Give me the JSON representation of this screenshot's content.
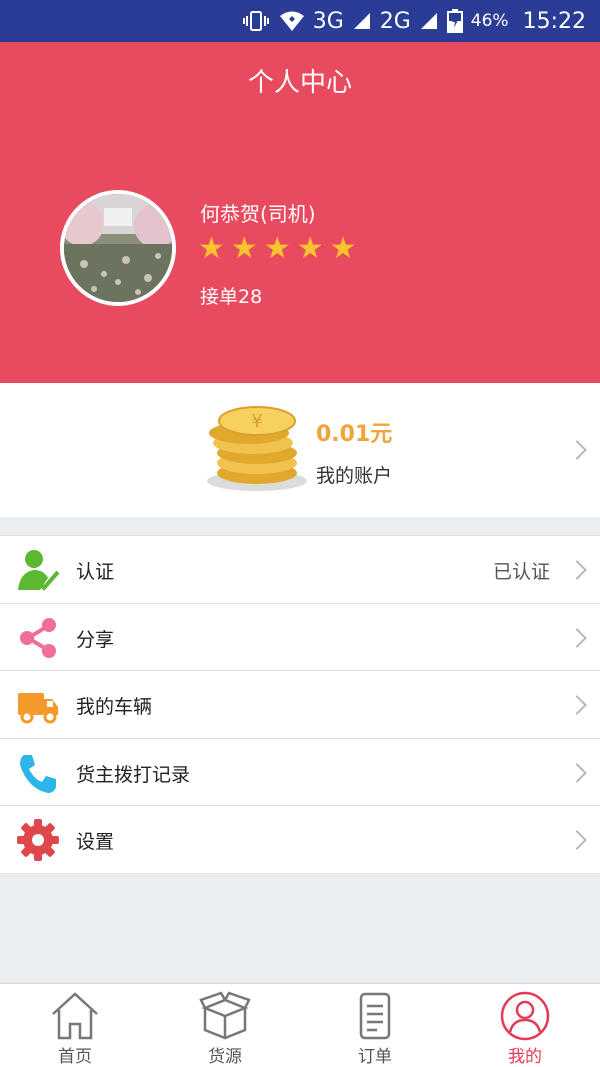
{
  "status_bar": {
    "network_3g": "3G",
    "network_2g": "2G",
    "battery": "46%",
    "time": "15:22"
  },
  "header": {
    "title": "个人中心",
    "name": "何恭贺(司机)",
    "rating_stars": 5,
    "orders": "接单28"
  },
  "account": {
    "balance": "0.01元",
    "label": "我的账户"
  },
  "menu": [
    {
      "label": "认证",
      "value": "已认证",
      "icon": "user-check-icon"
    },
    {
      "label": "分享",
      "value": "",
      "icon": "share-icon"
    },
    {
      "label": "我的车辆",
      "value": "",
      "icon": "truck-icon"
    },
    {
      "label": "货主拨打记录",
      "value": "",
      "icon": "phone-icon"
    },
    {
      "label": "设置",
      "value": "",
      "icon": "gear-icon"
    }
  ],
  "tabs": [
    {
      "label": "首页",
      "icon": "home-icon",
      "active": false
    },
    {
      "label": "货源",
      "icon": "box-icon",
      "active": false
    },
    {
      "label": "订单",
      "icon": "order-icon",
      "active": false
    },
    {
      "label": "我的",
      "icon": "user-icon",
      "active": true
    }
  ],
  "colors": {
    "status_bar": "#2b3c97",
    "header": "#e84a5f",
    "star": "#f9c22f",
    "balance": "#f0a43a",
    "tab_active": "#e43c55"
  }
}
